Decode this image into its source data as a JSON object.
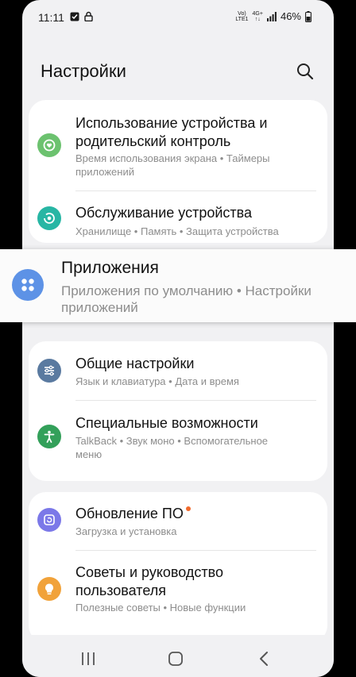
{
  "status_bar": {
    "time": "11:11",
    "network_top": "Vo)",
    "network_bottom": "LTE1",
    "data_top": "4G+",
    "data_bottom": "↑↓",
    "battery": "46%"
  },
  "header": {
    "title": "Настройки"
  },
  "card1": {
    "items": [
      {
        "title": "Использование устройства и родительский контроль",
        "subtitle": "Время использования экрана • Таймеры приложений",
        "icon": "digital-wellbeing-icon",
        "color": "#6cc26f"
      },
      {
        "title": "Обслуживание устройства",
        "subtitle": "Хранилище • Память • Защита устройства",
        "icon": "device-care-icon",
        "color": "#27b6a4"
      }
    ]
  },
  "highlight": {
    "title": "Приложения",
    "subtitle": "Приложения по умолчанию  •  Настройки приложений",
    "icon": "apps-icon",
    "color": "#5d92e6"
  },
  "card2": {
    "items": [
      {
        "title": "Общие настройки",
        "subtitle": "Язык и клавиатура • Дата и время",
        "icon": "general-settings-icon",
        "color": "#5a7aa0"
      },
      {
        "title": "Специальные возможности",
        "subtitle": "TalkBack • Звук моно • Вспомогательное меню",
        "icon": "accessibility-icon",
        "color": "#33a05a"
      }
    ]
  },
  "card3": {
    "items": [
      {
        "title": "Обновление ПО",
        "subtitle": "Загрузка и установка",
        "icon": "software-update-icon",
        "color": "#7b78e8",
        "badge_color": "#f16a2c"
      },
      {
        "title": "Советы и руководство пользователя",
        "subtitle": "Полезные советы • Новые функции",
        "icon": "tips-icon",
        "color": "#f1a23a"
      }
    ]
  },
  "navbar": {
    "recent": "recent-apps-icon",
    "home": "home-icon",
    "back": "back-icon"
  }
}
